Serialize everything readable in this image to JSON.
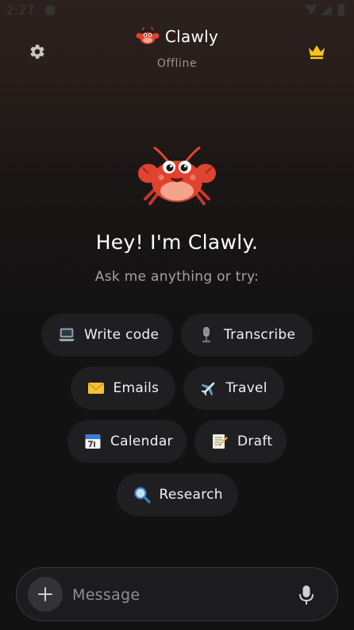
{
  "status_bar": {
    "time": "2:27"
  },
  "header": {
    "title": "Clawly",
    "status": "Offline",
    "settings_icon": "gear-icon",
    "premium_icon": "crown-icon",
    "accent_color": "#f5c518"
  },
  "hero": {
    "greeting": "Hey! I'm Clawly.",
    "subtitle": "Ask me anything or try:",
    "mascot_icon": "crab-icon"
  },
  "suggestions": [
    [
      {
        "label": "Write code",
        "icon": "laptop-icon"
      },
      {
        "label": "Transcribe",
        "icon": "microphone-icon"
      }
    ],
    [
      {
        "label": "Emails",
        "icon": "envelope-icon"
      },
      {
        "label": "Travel",
        "icon": "airplane-icon"
      }
    ],
    [
      {
        "label": "Calendar",
        "icon": "calendar-icon"
      },
      {
        "label": "Draft",
        "icon": "memo-icon"
      }
    ],
    [
      {
        "label": "Research",
        "icon": "magnifier-icon"
      }
    ]
  ],
  "composer": {
    "placeholder": "Message",
    "add_icon": "plus-icon",
    "mic_icon": "microphone-icon"
  },
  "colors": {
    "background": "#121212",
    "chip": "#1f1f21",
    "muted_text": "#a7a2a0",
    "crab_red": "#e0442e"
  }
}
